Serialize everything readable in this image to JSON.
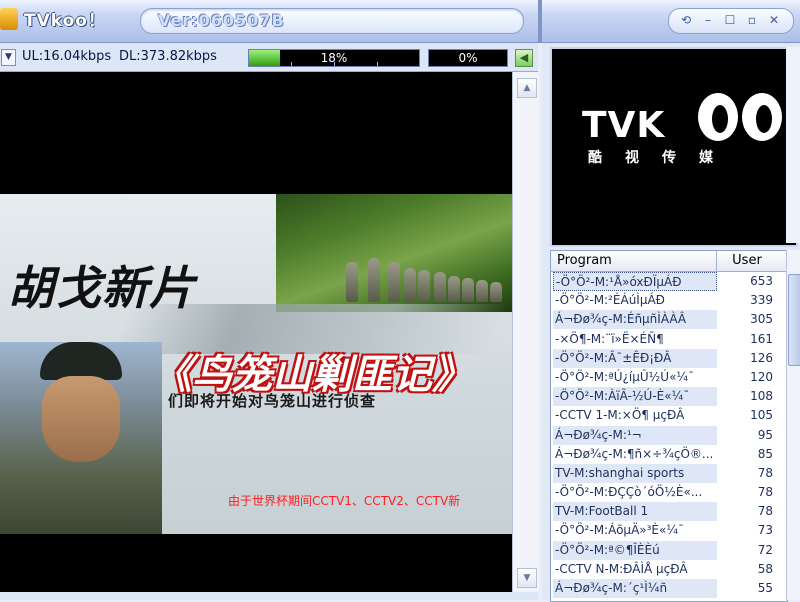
{
  "titlebar": {
    "app_title": "TVkoo！",
    "version": "Ver:060507B",
    "buttons": [
      "⟲",
      "–",
      "☐",
      "▫",
      "✕"
    ]
  },
  "status": {
    "upload": "UL:16.04kbps",
    "download": "DL:373.82kbps",
    "buffer_percent_text": "18%",
    "buffer_fraction": 0.18,
    "second_percent_text": "0%"
  },
  "poster": {
    "title": "胡戈新片",
    "movie_name": "《鸟笼山剿匪记》",
    "subtitle": "们即将开始对鸟笼山进行侦查"
  },
  "video": {
    "ticker": "由于世界杯期间CCTV1、CCTV2、CCTV新"
  },
  "preview": {
    "brand": "TVK",
    "brand_sub": "酷视传媒"
  },
  "channel_list": {
    "header_program": "Program",
    "header_user": "User",
    "rows": [
      {
        "program": "-Ö°Ö²-M:¹Å»óxÐÏµÁÐ",
        "user": "653"
      },
      {
        "program": "-Ö°Ö²-M:²ÉÁúÌµÁÐ",
        "user": "339"
      },
      {
        "program": "Á¬Ðø¾ç-M:É﻿ñµñÌÀÀÂ",
        "user": "305"
      },
      {
        "program": "-×Ö¶-M:¨ï»Ë×ÉÑ¶",
        "user": "161"
      },
      {
        "program": "-Ö°Ö²-M:Â¯±ÊÐ¡ÐÂ",
        "user": "126"
      },
      {
        "program": "-Ö°Ö²-M:ªÚ¿íµÛ½Ú«¼¯",
        "user": "120"
      },
      {
        "program": "-Ö°Ö²-M:ÀïÃ-½Ú-È«¼¯",
        "user": "108"
      },
      {
        "program": "-CCTV 1-M:×Ö¶ µçÐÂ",
        "user": "105"
      },
      {
        "program": "Á¬Ðø¾ç-M:¹¬",
        "user": "95"
      },
      {
        "program": "Á¬Ðø¾ç-M:¶ñ×÷¾çÖ®...",
        "user": "85"
      },
      {
        "program": "TV-M:shanghai sports",
        "user": "78"
      },
      {
        "program": "-Ö°Ö²-M:ÐÇÇò´óÖ½È«...",
        "user": "78"
      },
      {
        "program": "TV-M:FootBall 1",
        "user": "78"
      },
      {
        "program": "-Ö°Ö²-M:ÁõµÄ»³È«¼¯",
        "user": "73"
      },
      {
        "program": "-Ö°Ö²-M:ª©¶ÎÈÈú",
        "user": "72"
      },
      {
        "program": "-CCTV N-M:ÐÂÌÅ µçÐÂ",
        "user": "58"
      },
      {
        "program": "Á¬Ðø¾ç-M:´ç¹Ì¼ñ",
        "user": "55"
      }
    ]
  },
  "colors": {
    "accent": "#7f93c4",
    "progress_green": "#2fa010",
    "ticker_red": "#ff2020"
  },
  "icons": {
    "menu": "dropdown-arrow-icon",
    "next": "green-arrow-icon"
  }
}
